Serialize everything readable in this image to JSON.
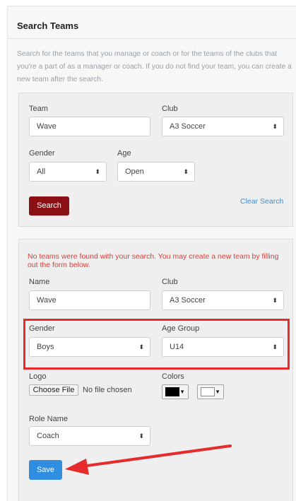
{
  "panel": {
    "title": "Search Teams",
    "intro": "Search for the teams that you manage or coach or for the teams of the clubs that you're a part of as a manager or coach. If you do not find your team, you can create a new team after the search."
  },
  "search": {
    "team_label": "Team",
    "team_value": "Wave",
    "club_label": "Club",
    "club_value": "A3 Soccer",
    "gender_label": "Gender",
    "gender_value": "All",
    "age_label": "Age",
    "age_value": "Open",
    "search_button": "Search",
    "clear_link": "Clear Search"
  },
  "create": {
    "error_message": "No teams were found with your search. You may create a new team by filling out the form below.",
    "name_label": "Name",
    "name_value": "Wave",
    "club_label": "Club",
    "club_value": "A3 Soccer",
    "gender_label": "Gender",
    "gender_value": "Boys",
    "age_group_label": "Age Group",
    "age_group_value": "U14",
    "logo_label": "Logo",
    "choose_file": "Choose File",
    "no_file": "No file chosen",
    "colors_label": "Colors",
    "color_primary": "#000000",
    "color_secondary": "#ffffff",
    "role_label": "Role Name",
    "role_value": "Coach",
    "save_button": "Save"
  },
  "colors": {
    "search_button": "#8b1015",
    "save_button": "#2f8ee0",
    "link": "#3a8fd6",
    "error": "#e03c32",
    "annotation": "#e52b2b"
  }
}
